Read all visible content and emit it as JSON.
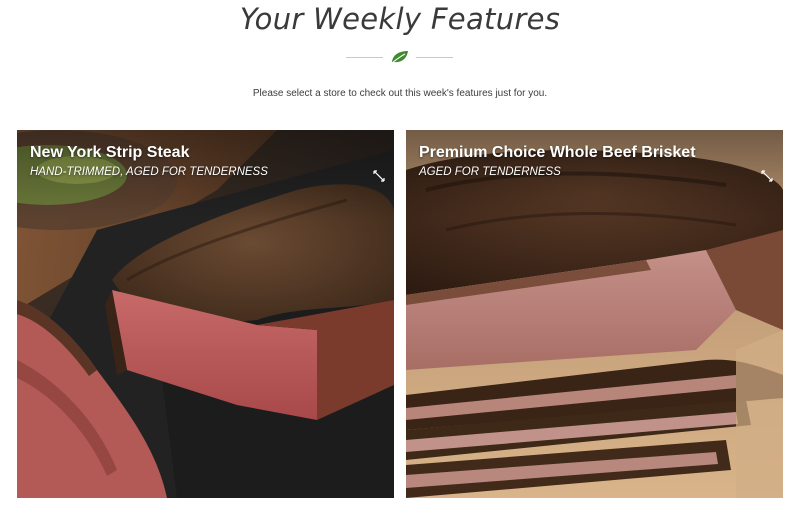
{
  "header": {
    "title": "Your Weekly Features",
    "subtitle": "Please select a store to check out this week's features just for you."
  },
  "colors": {
    "leaf_accent": "#3f8b2f",
    "divider_line": "#c9c9c9"
  },
  "features": [
    {
      "name": "New York Strip Steak",
      "tagline": "HAND-TRIMMED, AGED FOR TENDERNESS",
      "icon": "expand-arrows-icon"
    },
    {
      "name": "Premium Choice Whole Beef Brisket",
      "tagline": "AGED FOR TENDERNESS",
      "icon": "expand-arrows-icon"
    }
  ]
}
